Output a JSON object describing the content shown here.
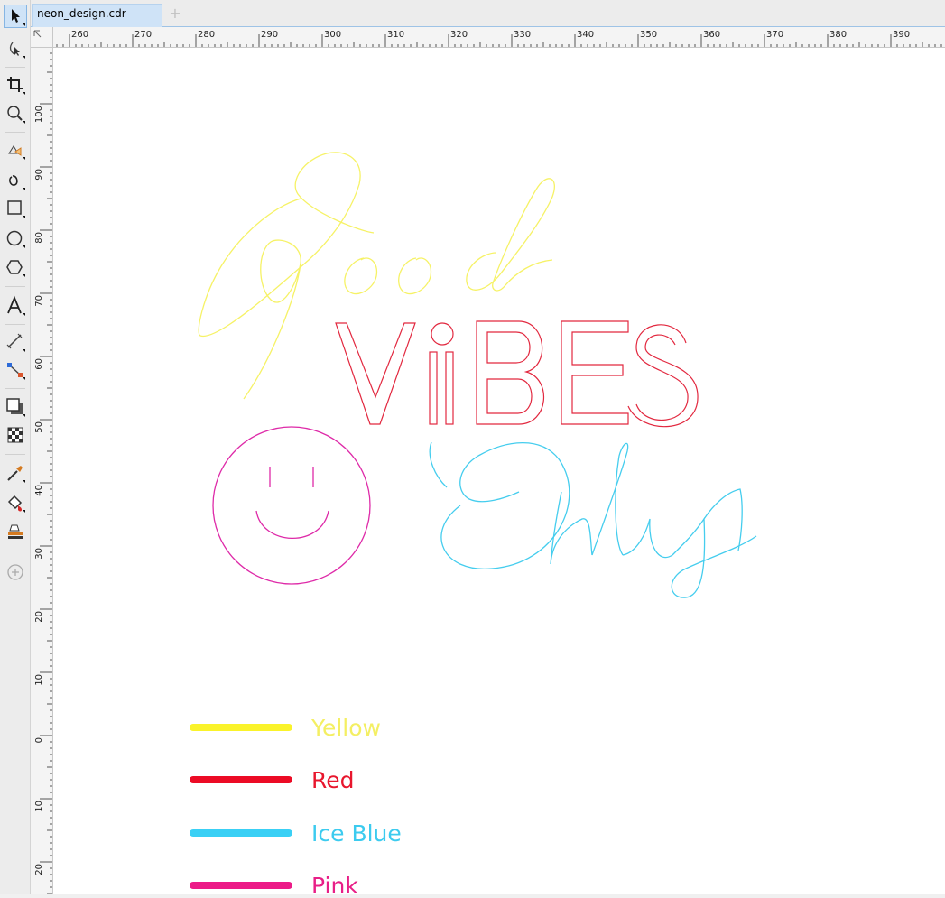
{
  "document": {
    "tab_title": "neon_design.cdr",
    "add_tab_glyph": "+"
  },
  "toolbox": {
    "tools": [
      {
        "name": "pick-tool",
        "icon": "arrow-pointer-icon"
      },
      {
        "name": "shape-tool",
        "icon": "shape-node-icon"
      },
      {
        "name": "crop-tool",
        "icon": "crop-icon"
      },
      {
        "name": "zoom-tool",
        "icon": "magnifier-icon"
      },
      {
        "name": "smart-fill-tool",
        "icon": "smart-fill-icon"
      },
      {
        "name": "freehand-tool",
        "icon": "freehand-curve-icon"
      },
      {
        "name": "rectangle-tool",
        "icon": "rectangle-icon"
      },
      {
        "name": "ellipse-tool",
        "icon": "ellipse-icon"
      },
      {
        "name": "polygon-tool",
        "icon": "polygon-icon"
      },
      {
        "name": "text-tool",
        "icon": "text-a-icon"
      },
      {
        "name": "parallel-dimension-tool",
        "icon": "dimension-line-icon"
      },
      {
        "name": "connector-tool",
        "icon": "connector-icon"
      },
      {
        "name": "drop-shadow-tool",
        "icon": "drop-shadow-icon"
      },
      {
        "name": "transparency-tool",
        "icon": "transparency-checker-icon"
      },
      {
        "name": "eyedropper-tool",
        "icon": "eyedropper-icon"
      },
      {
        "name": "interactive-fill-tool",
        "icon": "paint-bucket-icon"
      },
      {
        "name": "smart-fill-2-tool",
        "icon": "fill-stack-icon"
      },
      {
        "name": "add-tool",
        "icon": "plus-circle-icon"
      }
    ]
  },
  "rulers": {
    "horizontal_labels": [
      "260",
      "270",
      "280",
      "290",
      "300",
      "310",
      "320",
      "330",
      "340",
      "350",
      "360",
      "370",
      "380",
      "390"
    ],
    "vertical_labels": [
      "100",
      "90",
      "80",
      "70",
      "60",
      "50",
      "40",
      "30",
      "20",
      "10",
      "0",
      "10",
      "20"
    ]
  },
  "artwork": {
    "lines": [
      "Good",
      "ViBES",
      "Only"
    ],
    "colors": {
      "yellow": "#f6f266",
      "red": "#e2283f",
      "ice_blue": "#45cdee",
      "pink": "#de2aa8"
    }
  },
  "legend": [
    {
      "label": "Yellow",
      "swatch": "#faf32a",
      "text_color": "#f4ef63"
    },
    {
      "label": "Red",
      "swatch": "#ec0b25",
      "text_color": "#e8162d"
    },
    {
      "label": "Ice Blue",
      "swatch": "#3ad0f5",
      "text_color": "#3ccbef"
    },
    {
      "label": "Pink",
      "swatch": "#ec1b88",
      "text_color": "#e81f87"
    }
  ]
}
